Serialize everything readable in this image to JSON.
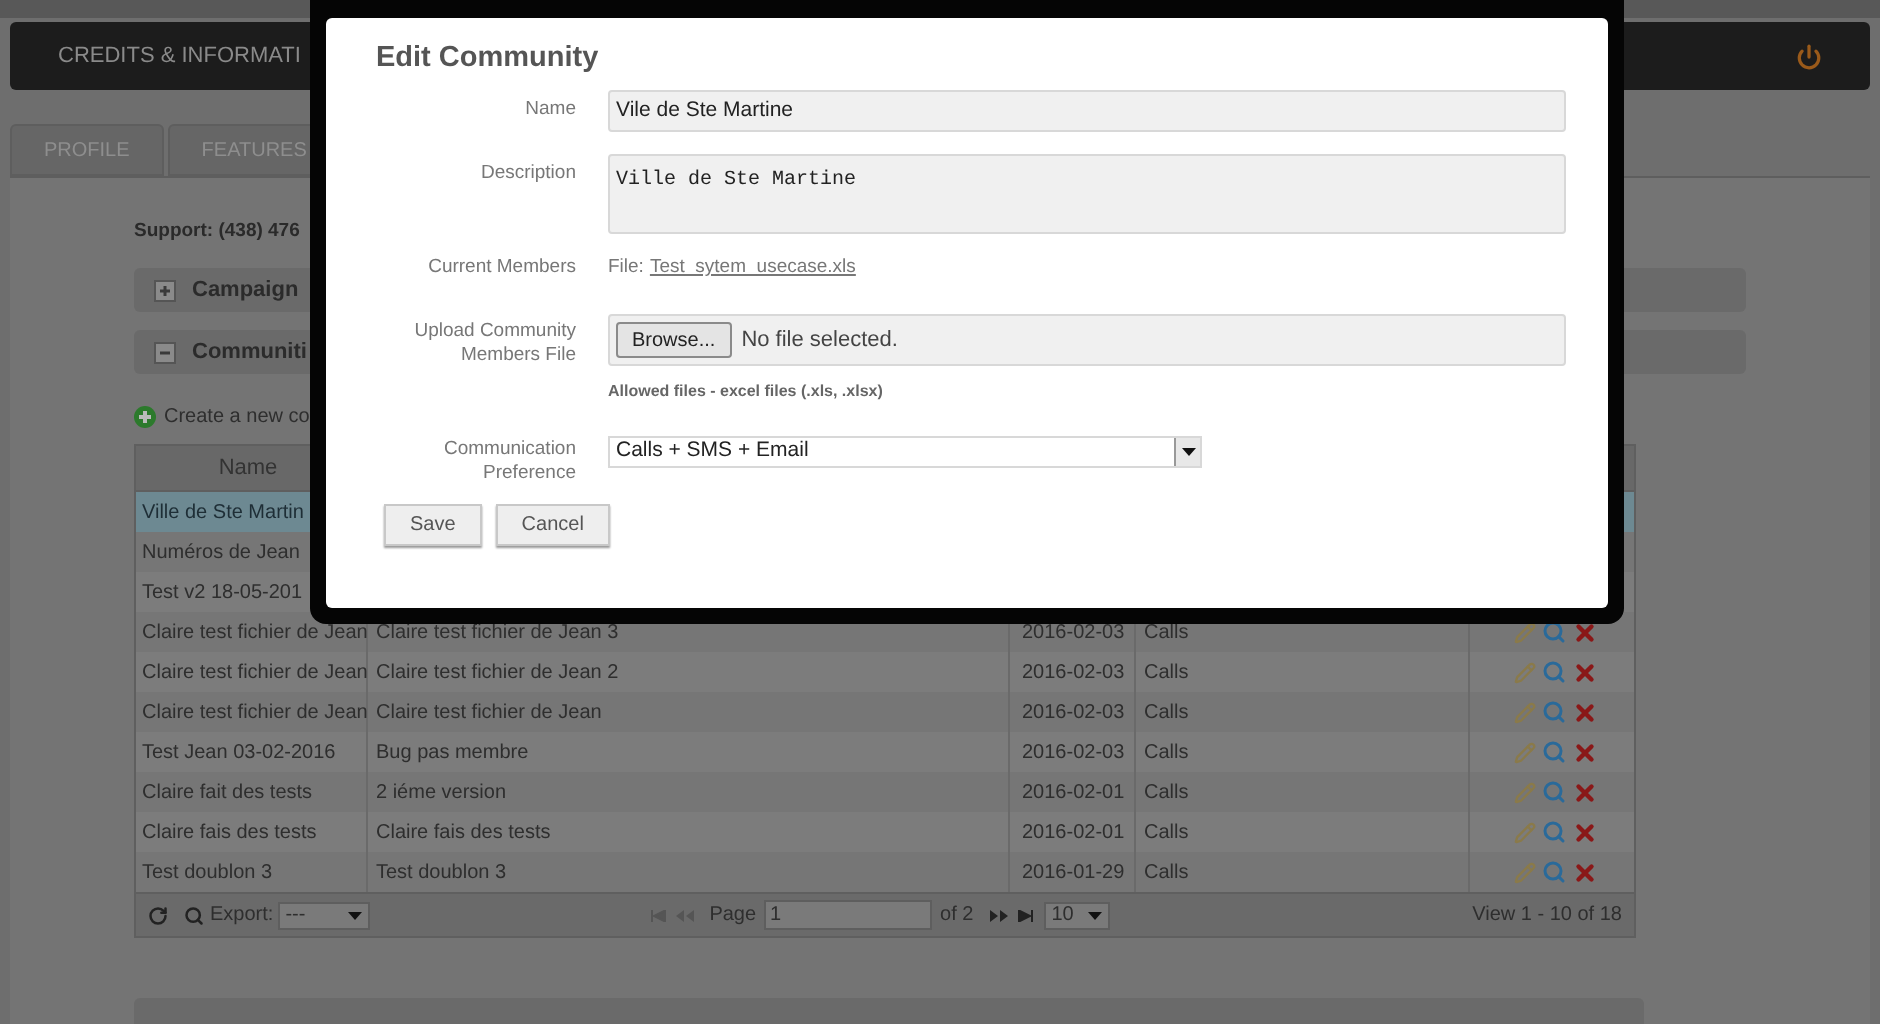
{
  "header": {
    "title": "CREDITS & INFORMATI"
  },
  "tabs": [
    {
      "label": "PROFILE",
      "selected": false
    },
    {
      "label": "FEATURES",
      "selected": false
    }
  ],
  "support": "Support: (438) 476",
  "sections": [
    {
      "title": "Campaign",
      "expanded": false
    },
    {
      "title": "Communiti",
      "expanded": true
    }
  ],
  "create_link": "Create a new co",
  "table": {
    "columns": [
      "Name"
    ],
    "rows": [
      {
        "name": "Ville de Ste Martin",
        "selected": true
      },
      {
        "name": "Numéros de Jean",
        "selected": false
      },
      {
        "name": "Test v2 18-05-201",
        "selected": false
      },
      {
        "name": "Claire test fichier de Jean",
        "description": "Claire test fichier de Jean 3",
        "date": "2016-02-03",
        "type": "Calls",
        "selected": false
      },
      {
        "name": "Claire test fichier de Jean",
        "description": "Claire test fichier de Jean 2",
        "date": "2016-02-03",
        "type": "Calls",
        "selected": false
      },
      {
        "name": "Claire test fichier de Jean",
        "description": "Claire test fichier de Jean",
        "date": "2016-02-03",
        "type": "Calls",
        "selected": false
      },
      {
        "name": "Test Jean 03-02-2016",
        "description": "Bug pas membre",
        "date": "2016-02-03",
        "type": "Calls",
        "selected": false
      },
      {
        "name": "Claire fait des tests",
        "description": "2 iéme version",
        "date": "2016-02-01",
        "type": "Calls",
        "selected": false
      },
      {
        "name": "Claire fais des tests",
        "description": "Claire fais des tests",
        "date": "2016-02-01",
        "type": "Calls",
        "selected": false
      },
      {
        "name": "Test doublon 3",
        "description": "Test doublon 3",
        "date": "2016-01-29",
        "type": "Calls",
        "selected": false
      }
    ]
  },
  "pager": {
    "export_label": "Export:",
    "export_value": "---",
    "page_label": "Page",
    "page_value": "1",
    "page_of": "of 2",
    "page_size": "10",
    "view": "View 1 - 10 of 18"
  },
  "dialog": {
    "title": "Edit Community",
    "name_label": "Name",
    "name_value": "Vile de Ste Martine",
    "description_label": "Description",
    "description_value": "Ville de Ste Martine",
    "members_label": "Current Members",
    "members_prefix": "File:",
    "members_file": "Test_sytem_usecase.xls",
    "upload_label": "Upload Community Members File",
    "browse": "Browse...",
    "no_file": "No file selected.",
    "allowed": "Allowed files - excel files (.xls, .xlsx)",
    "preference_label": "Communication Preference",
    "preference_value": "Calls + SMS + Email",
    "buttons": [
      "Save",
      "Cancel"
    ]
  }
}
